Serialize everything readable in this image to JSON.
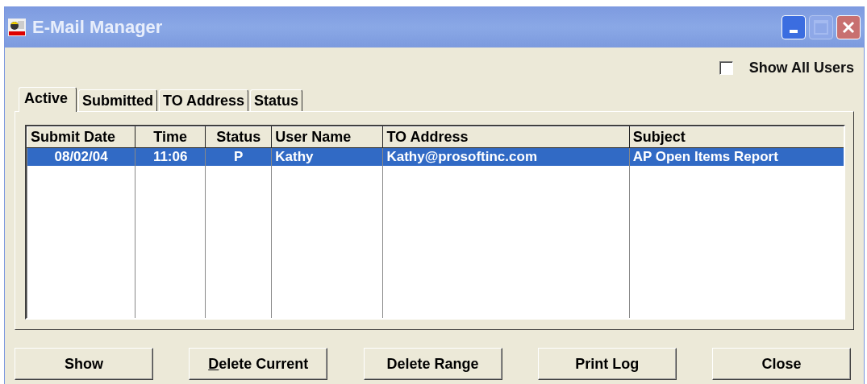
{
  "window": {
    "title": "E-Mail Manager",
    "maximize_disabled": true
  },
  "show_all_users": {
    "label": "Show All Users",
    "checked": false
  },
  "tabs": [
    {
      "label": "Active",
      "selected": true
    },
    {
      "label": "Submitted",
      "selected": false
    },
    {
      "label": "TO Address",
      "selected": false
    },
    {
      "label": "Status",
      "selected": false
    }
  ],
  "table": {
    "columns": [
      "Submit Date",
      "Time",
      "Status",
      "User Name",
      "TO Address",
      "Subject"
    ],
    "rows": [
      {
        "selected": true,
        "cells": [
          "08/02/04",
          "11:06",
          "P",
          "Kathy",
          "Kathy@prosoftinc.com",
          "AP Open Items Report"
        ]
      }
    ]
  },
  "buttons": [
    {
      "label": "Show"
    },
    {
      "mnemonic": "D",
      "label": "elete Current"
    },
    {
      "label": "Delete Range"
    },
    {
      "label": "Print Log"
    },
    {
      "label": "Close"
    }
  ]
}
